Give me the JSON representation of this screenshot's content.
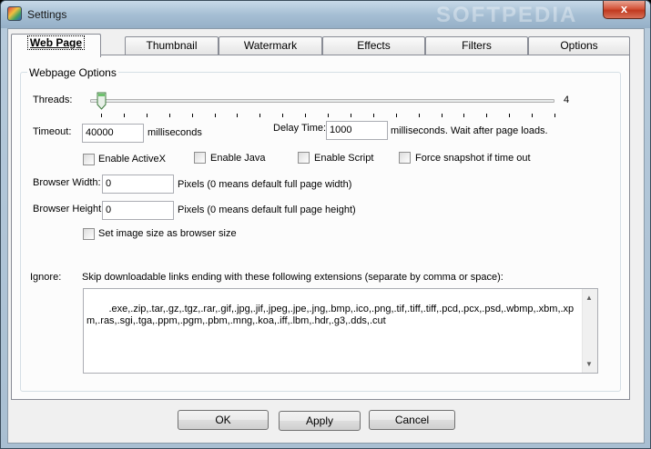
{
  "window": {
    "title": "Settings",
    "close_label": "x",
    "watermark": "SOFTPEDIA"
  },
  "tabs": [
    {
      "label": "Web Page",
      "active": true
    },
    {
      "label": "Thumbnail"
    },
    {
      "label": "Watermark"
    },
    {
      "label": "Effects"
    },
    {
      "label": "Filters"
    },
    {
      "label": "Options"
    }
  ],
  "group": {
    "title": "Webpage Options"
  },
  "threads": {
    "label": "Threads:",
    "value": "4",
    "slider_position": 1
  },
  "timeout": {
    "label": "Timeout:",
    "value": "40000",
    "unit": "milliseconds"
  },
  "delay": {
    "label": "Delay Time:",
    "value": "1000",
    "unit": "milliseconds. Wait after page loads."
  },
  "checks": {
    "activex": "Enable ActiveX",
    "java": "Enable Java",
    "script": "Enable Script",
    "force": "Force snapshot if time out",
    "image_size": "Set image size as browser size"
  },
  "browser_width": {
    "label": "Browser Width:",
    "value": "0",
    "hint": "Pixels (0 means default full page width)"
  },
  "browser_height": {
    "label": "Browser Height:",
    "value": "0",
    "hint": "Pixels (0 means default full page height)"
  },
  "ignore": {
    "label": "Ignore:",
    "description": "Skip downloadable links ending with these following extensions (separate by comma or space):",
    "value": ".exe,.zip,.tar,.gz,.tgz,.rar,.gif,.jpg,.jif,.jpeg,.jpe,.jng,.bmp,.ico,.png,.tif,.tiff,.tiff,.pcd,.pcx,.psd,.wbmp,.xbm,.xpm,.ras,.sgi,.tga,.ppm,.pgm,.pbm,.mng,.koa,.iff,.lbm,.hdr,.g3,.dds,.cut"
  },
  "buttons": {
    "ok": "OK",
    "apply": "Apply",
    "cancel": "Cancel"
  }
}
